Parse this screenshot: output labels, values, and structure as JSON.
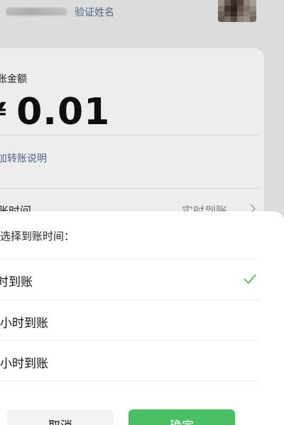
{
  "header": {
    "verify_name_link": "验证姓名"
  },
  "transfer": {
    "amount_label": "账金额",
    "currency_symbol": "¥",
    "amount": "0.01",
    "add_note_link": "加转账说明",
    "arrival_time_label": "账时间",
    "arrival_time_value": "实时到账"
  },
  "sheet": {
    "title": "选择到账时间：",
    "options": [
      {
        "label": "时到账",
        "selected": true
      },
      {
        "label": "小时到账",
        "selected": false
      },
      {
        "label": "小时到账",
        "selected": false
      }
    ],
    "cancel_label": "取消",
    "confirm_label": "确定"
  },
  "colors": {
    "link": "#576b95",
    "check": "#4cbf66",
    "confirm_button": "#4cbf66",
    "cancel_button": "#f2f2f2"
  },
  "icons": {
    "chevron": "chevron-right-icon",
    "check": "check-icon"
  }
}
